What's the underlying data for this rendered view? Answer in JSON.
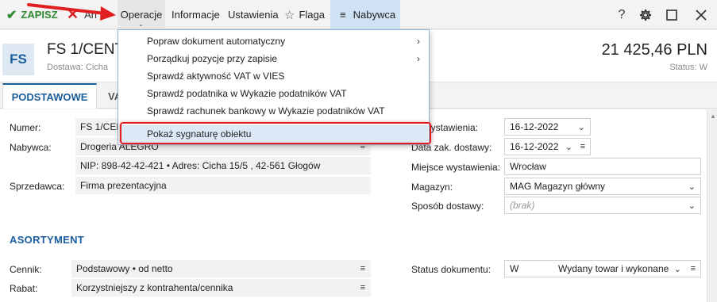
{
  "toolbar": {
    "save": "ZAPISZ",
    "cancel": "An",
    "operations": "Operacje",
    "info": "Informacje",
    "settings": "Ustawienia",
    "flag": "Flaga",
    "buyer": "Nabywca",
    "help": "?"
  },
  "header": {
    "badge": "FS",
    "title": "FS 1/CENT",
    "subtitle": "Dostawa: Cicha",
    "amount": "21 425,46 PLN",
    "status": "Status:  W"
  },
  "tabs": {
    "basic": "PODSTAWOWE",
    "second": "VA"
  },
  "form": {
    "numer_label": "Numer:",
    "numer_value": "FS 1/CEN",
    "nabywca_label": "Nabywca:",
    "nabywca_value": "Drogeria ALEGRO",
    "nip_line": "NIP:  898-42-42-421  •  Adres:  Cicha  15/5 , 42-561 Głogów",
    "sprzedawca_label": "Sprzedawca:",
    "sprzedawca_value": "Firma prezentacyjna",
    "data_wyst_label": "wystawienia:",
    "data_wyst_value": "16-12-2022",
    "data_zak_label": "Data zak. dostawy:",
    "data_zak_value": "16-12-2022",
    "miejsce_label": "Miejsce wystawienia:",
    "miejsce_value": "Wrocław",
    "magazyn_label": "Magazyn:",
    "magazyn_value": "MAG  Magazyn główny",
    "sposob_label": "Sposób dostawy:",
    "sposob_placeholder": "(brak)"
  },
  "assortment": {
    "title": "ASORTYMENT",
    "cennik_label": "Cennik:",
    "cennik_value": "Podstawowy • od netto",
    "rabat_label": "Rabat:",
    "rabat_value": "Korzystniejszy z kontrahenta/cennika",
    "status_label": "Status dokumentu:",
    "status_code": "W",
    "status_value": "Wydany towar i wykonane"
  },
  "menu": {
    "items": [
      {
        "label": "Popraw dokument automatyczny",
        "submenu": true
      },
      {
        "label": "Porządkuj pozycje przy zapisie",
        "submenu": true
      },
      {
        "label": "Sprawdź aktywność VAT w VIES",
        "submenu": false
      },
      {
        "label": "Sprawdź podatnika w Wykazie podatników VAT",
        "submenu": false
      },
      {
        "label": "Sprawdź rachunek bankowy w Wykazie podatników VAT",
        "submenu": false
      },
      {
        "label": "Pokaż sygnaturę obiektu",
        "submenu": false
      }
    ],
    "highlighted_index": 5
  },
  "colors": {
    "accent": "#1b5e9e",
    "save_green": "#2e8b2e",
    "cancel_red": "#d92020",
    "annotation_red": "#e02020",
    "menu_highlight": "#dde9f6"
  },
  "icons": [
    "check-icon",
    "cross-icon",
    "star-icon",
    "hamburger-icon",
    "help-icon",
    "gear-icon",
    "maximize-icon",
    "close-icon",
    "chevron-right-icon",
    "chevron-down-icon",
    "menu-lines-icon"
  ]
}
